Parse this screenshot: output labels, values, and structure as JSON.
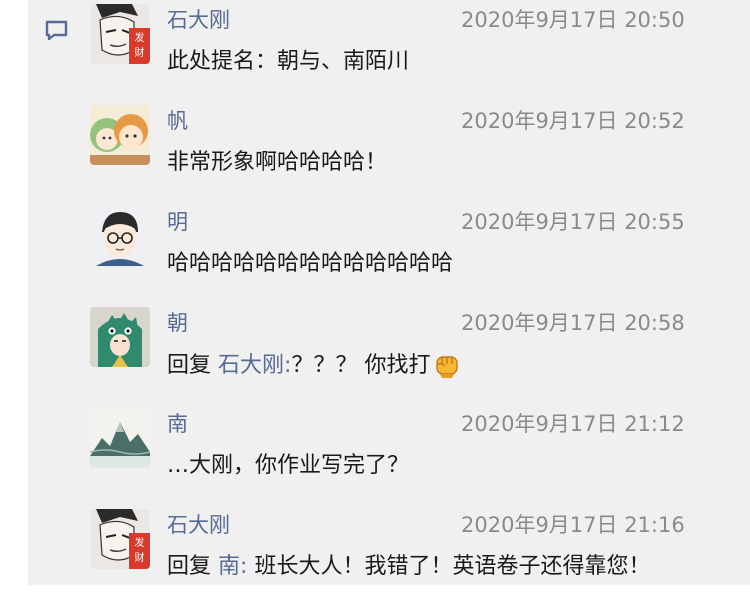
{
  "comments": [
    {
      "nickname": "石大刚",
      "time": "2020年9月17日 20:50",
      "text": "此处提名：朝与、南陌川"
    },
    {
      "nickname": "帆",
      "time": "2020年9月17日 20:52",
      "text": "非常形象啊哈哈哈哈！"
    },
    {
      "nickname": "明",
      "time": "2020年9月17日 20:55",
      "text": "哈哈哈哈哈哈哈哈哈哈哈哈哈"
    },
    {
      "nickname": "朝",
      "time": "2020年9月17日 20:58",
      "reply_word": "回复",
      "reply_to": "石大刚",
      "separator": ":",
      "text": "？？？ 你找打"
    },
    {
      "nickname": "南",
      "time": "2020年9月17日 21:12",
      "text": "…大刚，你作业写完了？"
    },
    {
      "nickname": "石大刚",
      "time": "2020年9月17日 21:16",
      "reply_word": "回复",
      "reply_to": "南",
      "separator": ":",
      "text": "班长大人！我错了！英语卷子还得靠您！"
    }
  ],
  "avatar_badge": "发财",
  "emoji_name": "fist-emoji",
  "icons": {
    "comment": "comment-bubble-icon"
  },
  "colors": {
    "nickname": "#576b95",
    "time": "#8a8a8a",
    "text": "#1a1a1a",
    "panel": "#f0f0f0"
  }
}
